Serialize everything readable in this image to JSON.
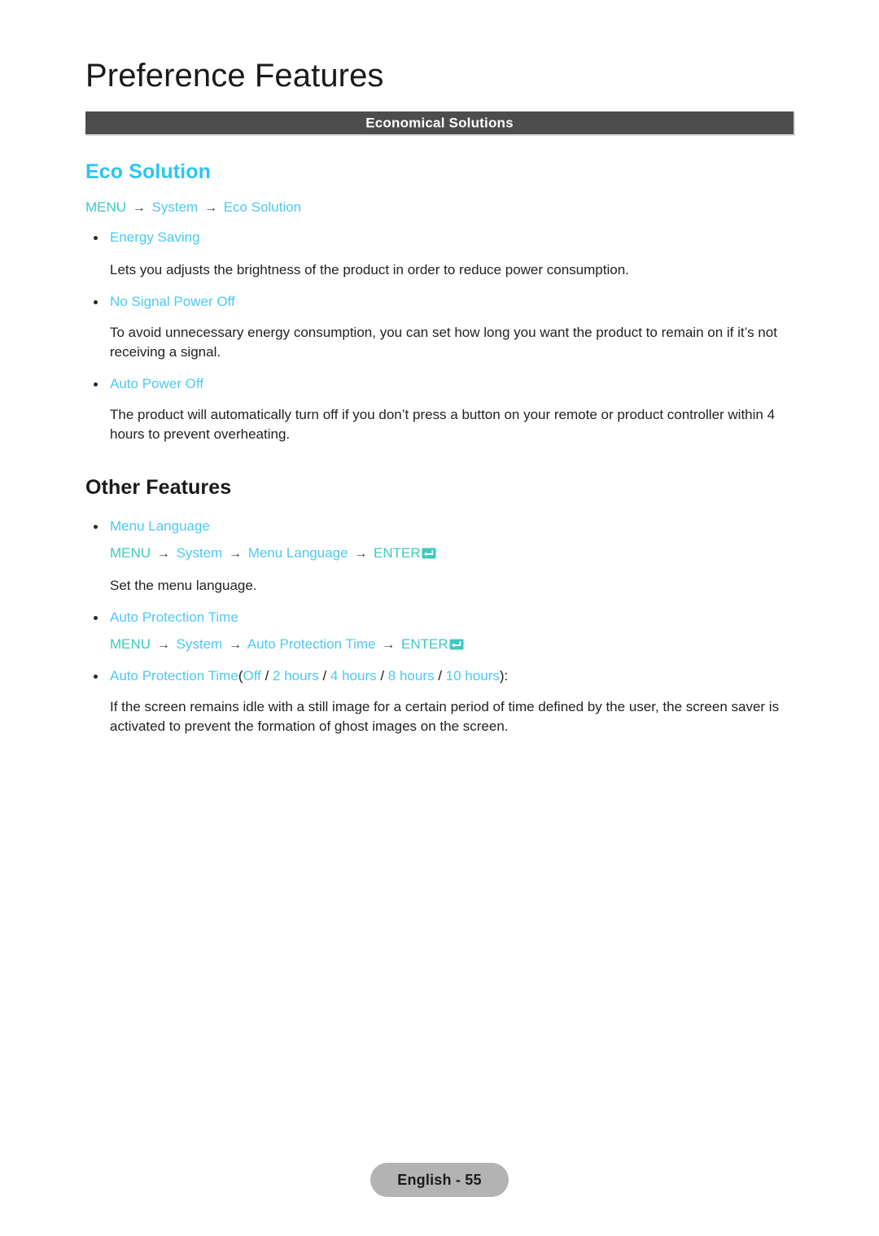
{
  "page": {
    "chapter_title": "Preference Features",
    "section_bar_label": "Economical Solutions",
    "footer_label": "English - 55"
  },
  "colors": {
    "accent_blue": "#4cc9f5",
    "heading_blue": "#2bc4f3",
    "menu_root_teal": "#3fc9bd",
    "bar_background": "#4d4d4d",
    "footer_pill": "#b3b3b3",
    "body_text": "#231f20"
  },
  "icons": {
    "enter_key": "enter-key-icon",
    "arrow": "→",
    "bullet": "•"
  },
  "eco_solution": {
    "heading": "Eco Solution",
    "menu_path": {
      "root": "MENU",
      "nodes": [
        "System",
        "Eco Solution"
      ]
    },
    "items": [
      {
        "label": "Energy Saving",
        "body": "Lets you adjusts the brightness of the product in order to reduce power consumption."
      },
      {
        "label": "No Signal Power Off",
        "body": "To avoid unnecessary energy consumption, you can set how long you want the product to remain on if it’s not receiving a signal."
      },
      {
        "label": "Auto Power Off",
        "body": "The product will automatically turn off if you don’t press a button on your remote or product controller within 4 hours to prevent overheating."
      }
    ]
  },
  "other_features": {
    "heading": "Other Features",
    "menu_language": {
      "label": "Menu Language",
      "menu_path": {
        "root": "MENU",
        "nodes": [
          "System",
          "Menu Language"
        ],
        "enter": "ENTER"
      },
      "body": "Set the menu language."
    },
    "auto_protection_time": {
      "label": "Auto Protection Time",
      "menu_path": {
        "root": "MENU",
        "nodes": [
          "System",
          "Auto Protection Time"
        ],
        "enter": "ENTER"
      },
      "options_line": {
        "label": "Auto Protection Time",
        "open_paren": "(",
        "options": [
          "Off",
          "2 hours",
          "4 hours",
          "8 hours",
          "10 hours"
        ],
        "separator": " / ",
        "close_paren": "):"
      },
      "body": "If the screen remains idle with a still image for a certain period of time defined by the user, the screen saver is activated to prevent the formation of ghost images on the screen."
    }
  }
}
